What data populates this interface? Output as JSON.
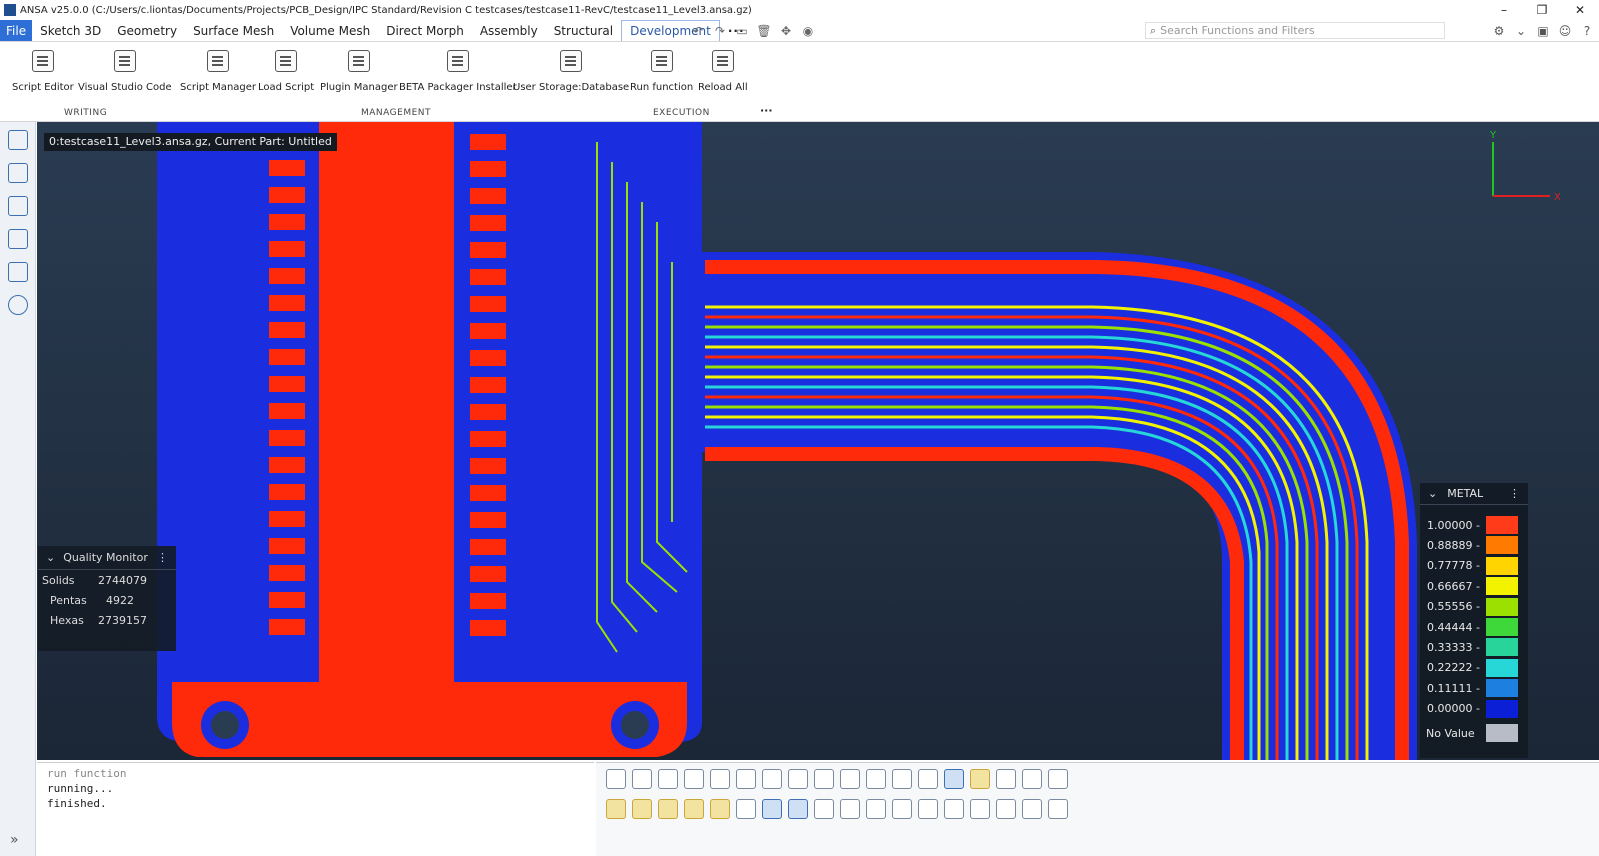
{
  "window": {
    "title": "ANSA v25.0.0 (C:/Users/c.liontas/Documents/Projects/PCB_Design/IPC Standard/Revision C testcases/testcase11-RevC/testcase11_Level3.ansa.gz)",
    "minimize": "–",
    "maximize": "❐",
    "close": "✕"
  },
  "menu": {
    "items": [
      "File",
      "Sketch 3D",
      "Geometry",
      "Surface Mesh",
      "Volume Mesh",
      "Direct Morph",
      "Assembly",
      "Structural",
      "Development"
    ],
    "active": "Development",
    "more": "···"
  },
  "search": {
    "placeholder": "Search Functions and Filters",
    "icon": "search-icon"
  },
  "ribbon": {
    "groups": [
      {
        "label": "WRITING",
        "buttons": [
          "Script Editor",
          "Visual Studio Code"
        ]
      },
      {
        "label": "MANAGEMENT",
        "buttons": [
          "Script Manager",
          "Load Script",
          "Plugin Manager",
          "BETA Packager Installer",
          "User Storage:Database"
        ]
      },
      {
        "label": "EXECUTION",
        "buttons": [
          "Run function",
          "Reload All"
        ]
      }
    ],
    "more": "···"
  },
  "viewport": {
    "caption": "0:testcase11_Level3.ansa.gz,  Current Part: Untitled",
    "axis_x": "X",
    "axis_y": "Y"
  },
  "quality_monitor": {
    "title": "Quality Monitor",
    "rows": [
      {
        "label": "Solids",
        "value": "2744079"
      },
      {
        "label": "Pentas",
        "value": "4922"
      },
      {
        "label": "Hexas",
        "value": "2739157"
      }
    ]
  },
  "legend": {
    "title": "METAL",
    "entries": [
      {
        "label": "1.00000 -",
        "color": "#ff3b1a"
      },
      {
        "label": "0.88889 -",
        "color": "#ff7a00"
      },
      {
        "label": "0.77778 -",
        "color": "#ffd400"
      },
      {
        "label": "0.66667 -",
        "color": "#f3f300"
      },
      {
        "label": "0.55556 -",
        "color": "#9be000"
      },
      {
        "label": "0.44444 -",
        "color": "#3fd83a"
      },
      {
        "label": "0.33333 -",
        "color": "#29d49a"
      },
      {
        "label": "0.22222 -",
        "color": "#27d6d6"
      },
      {
        "label": "0.11111 -",
        "color": "#1d7fe0"
      },
      {
        "label": "0.00000 -",
        "color": "#0b1fd6"
      }
    ],
    "no_value": {
      "label": "No Value",
      "color": "#b8bcc6"
    }
  },
  "console": {
    "lines": [
      "run function",
      "running...",
      "finished."
    ]
  },
  "colors": {
    "pcb_blue": "#1a2ee0",
    "copper_red": "#ff2a0a",
    "trace_green": "#9be000"
  }
}
